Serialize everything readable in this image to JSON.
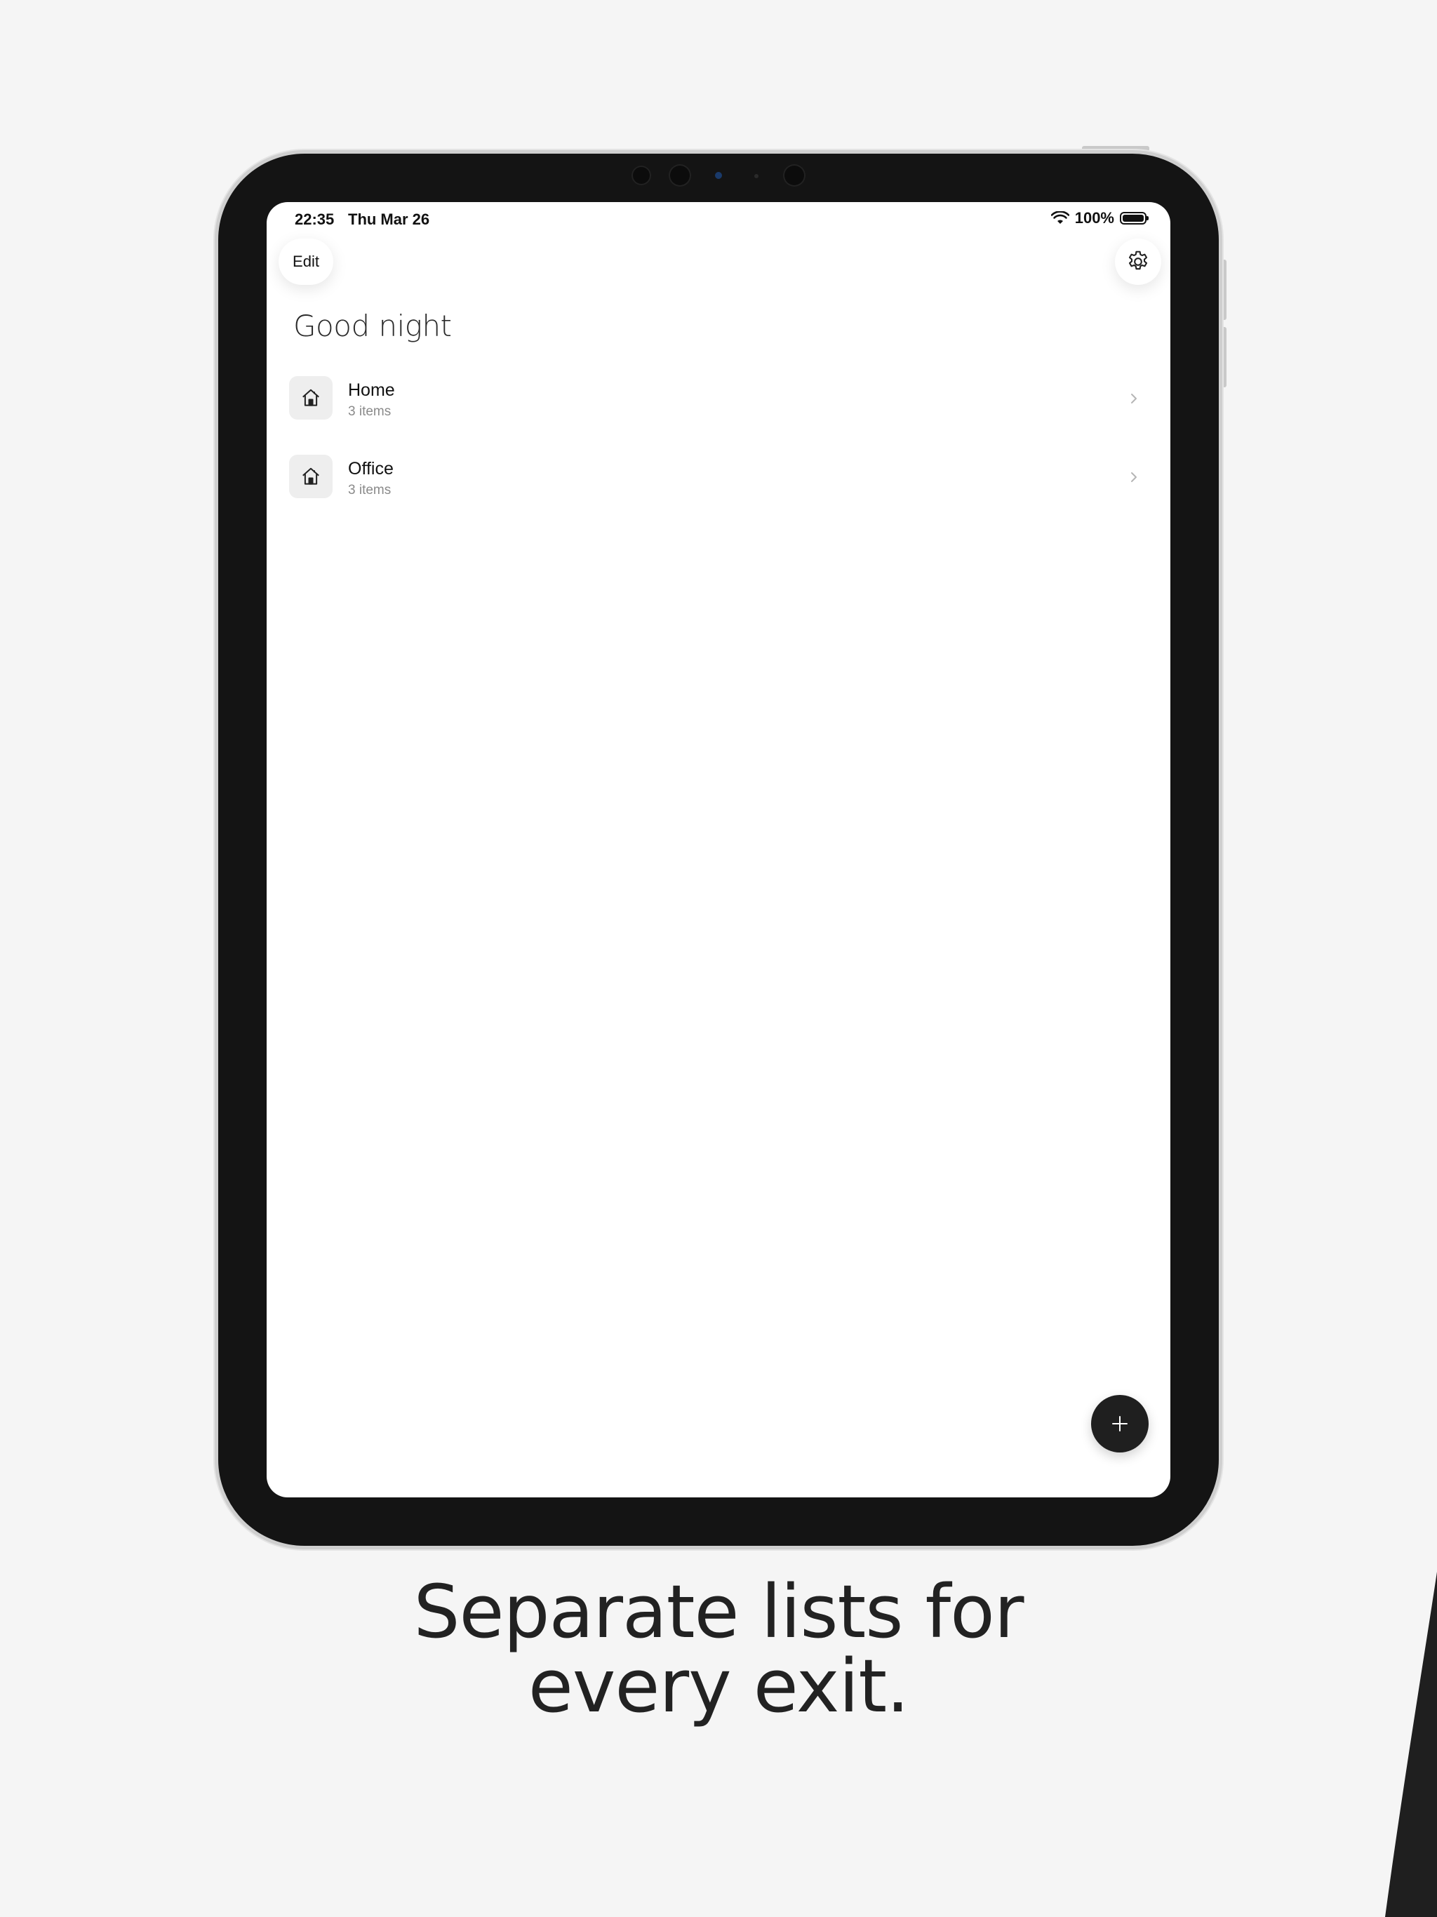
{
  "status_bar": {
    "time": "22:35",
    "date": "Thu Mar 26",
    "battery": "100%",
    "battery_level": 1.0,
    "wifi_icon": "wifi-icon"
  },
  "header": {
    "edit_label": "Edit",
    "settings_icon": "gear-icon"
  },
  "greeting": "Good night",
  "lists": [
    {
      "title": "Home",
      "subtitle": "3 items",
      "icon": "house-icon"
    },
    {
      "title": "Office",
      "subtitle": "3 items",
      "icon": "house-icon"
    }
  ],
  "fab": {
    "icon": "plus-icon"
  },
  "caption": {
    "line1": "Separate lists for",
    "line2": "every exit."
  },
  "colors": {
    "background": "#f5f5f5",
    "device_frame": "#141414",
    "fab": "#1f1f1f",
    "text_primary": "#111111",
    "text_secondary": "#8a8a8a"
  }
}
